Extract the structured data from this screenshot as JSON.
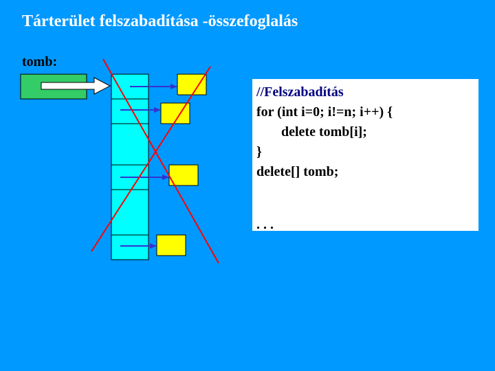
{
  "slide": {
    "title": "Tárterület felszabadítása -összefoglalás",
    "variable_label": "tomb:"
  },
  "code": {
    "comment": "//Felszabadítás",
    "for_line": "for (int i=0; i!=n; i++) {",
    "body_line": "delete tomb[i];",
    "close_brace": "}",
    "delete_array": "delete[] tomb;",
    "ellipsis": ". . ."
  },
  "colors": {
    "background": "#0099ff",
    "pointer_box": "#33cc66",
    "array_cell": "#00ffff",
    "target_box": "#ffff00",
    "arrow": "#3333cc",
    "cross": "#ff0000"
  }
}
